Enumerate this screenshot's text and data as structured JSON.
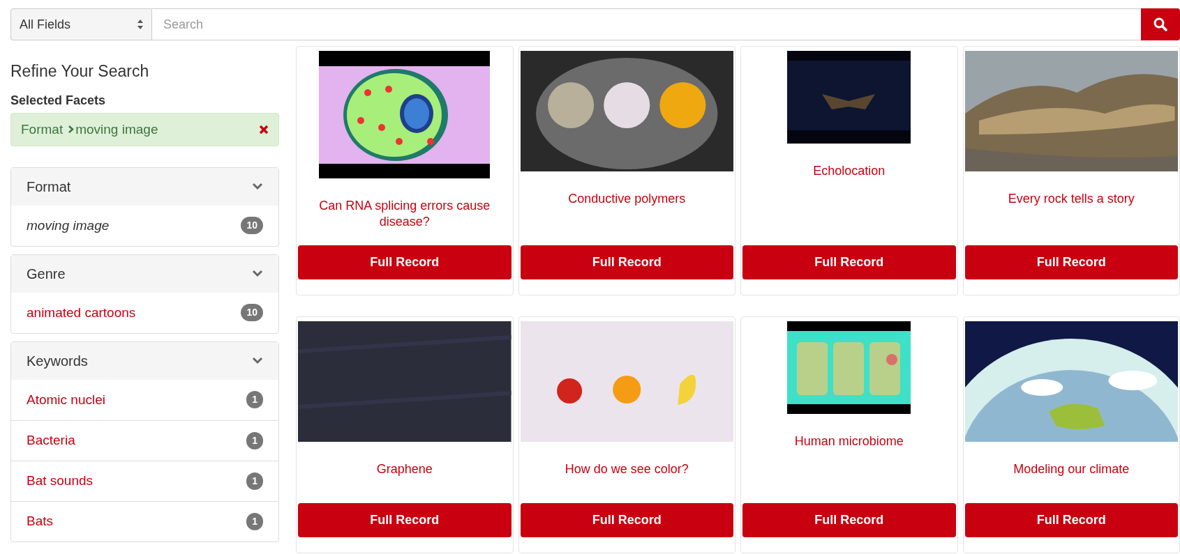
{
  "search": {
    "field_select": "All Fields",
    "placeholder": "Search"
  },
  "sidebar": {
    "title": "Refine Your Search",
    "selected_heading": "Selected Facets",
    "selected_facets": [
      {
        "field": "Format",
        "value": "moving image"
      }
    ],
    "facets": [
      {
        "title": "Format",
        "expanded": true,
        "items": [
          {
            "label": "moving image",
            "count": "10",
            "selected": true
          }
        ]
      },
      {
        "title": "Genre",
        "expanded": true,
        "items": [
          {
            "label": "animated cartoons",
            "count": "10",
            "selected": false
          }
        ]
      },
      {
        "title": "Keywords",
        "expanded": true,
        "items": [
          {
            "label": "Atomic nuclei",
            "count": "1",
            "selected": false
          },
          {
            "label": "Bacteria",
            "count": "1",
            "selected": false
          },
          {
            "label": "Bat sounds",
            "count": "1",
            "selected": false
          },
          {
            "label": "Bats",
            "count": "1",
            "selected": false
          }
        ]
      }
    ]
  },
  "results": [
    {
      "title": "Can RNA splicing errors cause disease?",
      "button": "Full Record"
    },
    {
      "title": "Conductive polymers",
      "button": "Full Record"
    },
    {
      "title": "Echolocation",
      "button": "Full Record"
    },
    {
      "title": "Every rock tells a story",
      "button": "Full Record"
    },
    {
      "title": "Graphene",
      "button": "Full Record"
    },
    {
      "title": "How do we see color?",
      "button": "Full Record"
    },
    {
      "title": "Human microbiome",
      "button": "Full Record"
    },
    {
      "title": "Modeling our climate",
      "button": "Full Record"
    }
  ]
}
